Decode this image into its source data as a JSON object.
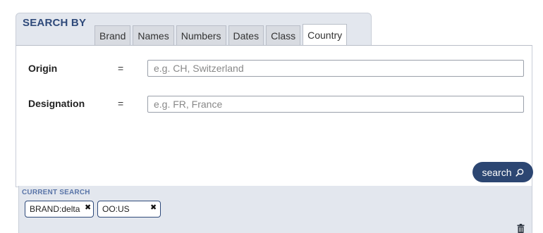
{
  "search_by": {
    "title": "SEARCH BY",
    "tabs": [
      {
        "label": "Brand",
        "active": false
      },
      {
        "label": "Names",
        "active": false
      },
      {
        "label": "Numbers",
        "active": false
      },
      {
        "label": "Dates",
        "active": false
      },
      {
        "label": "Class",
        "active": false
      },
      {
        "label": "Country",
        "active": true
      }
    ]
  },
  "form": {
    "fields": [
      {
        "label": "Origin",
        "operator": "=",
        "value": "",
        "placeholder": "e.g. CH, Switzerland"
      },
      {
        "label": "Designation",
        "operator": "=",
        "value": "",
        "placeholder": "e.g. FR, France"
      }
    ],
    "search_button": {
      "label": "search",
      "icon": "magnifier-icon"
    }
  },
  "current_search": {
    "title": "CURRENT SEARCH",
    "chips": [
      {
        "label": "BRAND:delta"
      },
      {
        "label": "OO:US"
      }
    ],
    "clear_icon": "trash-icon"
  },
  "colors": {
    "accent": "#2c4672",
    "header_bg": "#e3e7ee",
    "label_blue": "#5a75a8"
  }
}
